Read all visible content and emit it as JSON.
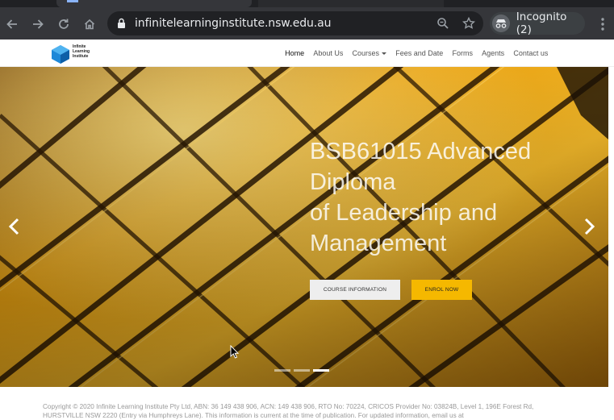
{
  "browser": {
    "url": "infinitelearninginstitute.nsw.edu.au",
    "incognito_label": "Incognito (2)",
    "icons": [
      "back-icon",
      "forward-icon",
      "reload-icon",
      "home-icon",
      "lock-icon",
      "zoom-icon",
      "star-icon",
      "incognito-icon",
      "menu-icon"
    ]
  },
  "site": {
    "logo_text": "Infinite Learning Institute",
    "nav": {
      "home": "Home",
      "about": "About Us",
      "courses": "Courses",
      "fees": "Fees and Date",
      "forms": "Forms",
      "agents": "Agents",
      "contact": "Contact us"
    },
    "hero": {
      "title": "BSB61015 Advanced\nDiploma\nof Leadership and\nManagement",
      "course_info_label": "COURSE INFORMATION",
      "enrol_label": "ENROL NOW",
      "slide_count": 3,
      "active_slide": 3
    },
    "footer_text": "Copyright © 2020 Infinite Learning Institute Pty Ltd, ABN: 36 149 438 906, ACN: 149 438 906, RTO No: 70224, CRICOS Provider No: 03824B, Level 1, 196E Forest Rd, HURSTVILLE NSW 2220 (Entry via Humphreys Lane). This information is current at the time of publication. For updated information, email us at"
  },
  "colors": {
    "chrome_dark": "#202124",
    "chrome_toolbar": "#35363a",
    "enrol_button": "#f5b800",
    "hero_gold": "#e8a010"
  }
}
